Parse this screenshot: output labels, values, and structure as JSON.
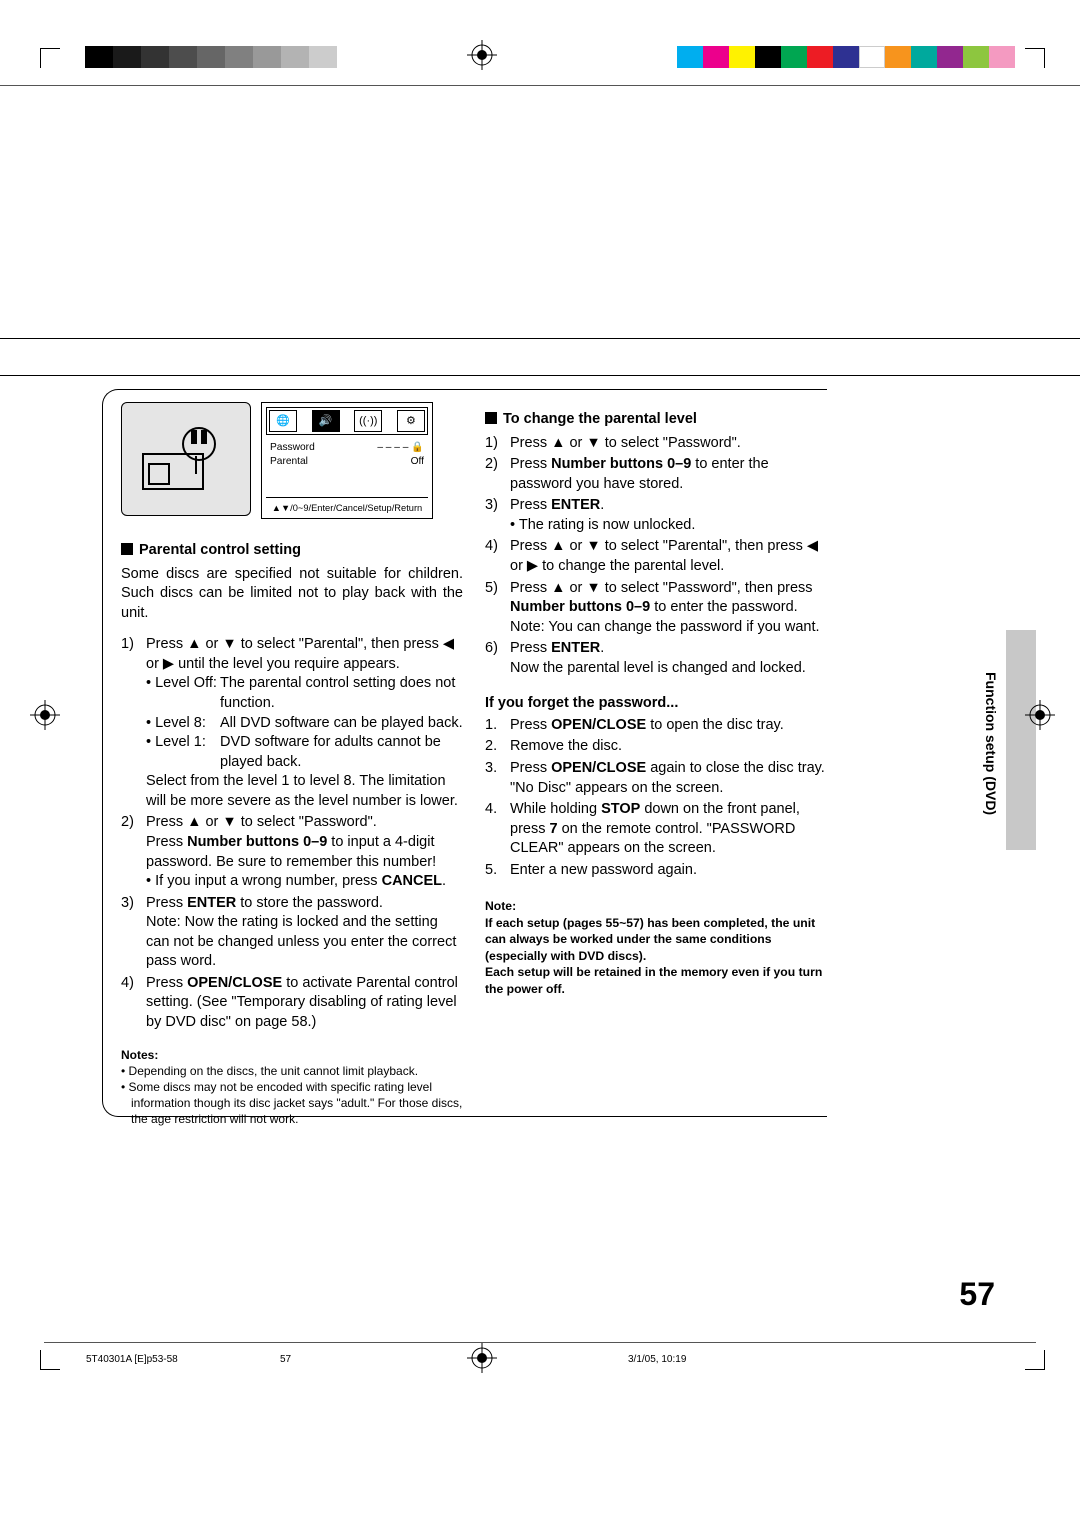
{
  "print": {
    "gray_shades": [
      "#000",
      "#1a1a1a",
      "#333",
      "#4d4d4d",
      "#666",
      "#808080",
      "#999",
      "#b3b3b3",
      "#ccc"
    ],
    "colors": [
      "#00aeef",
      "#ec008c",
      "#fff200",
      "#000",
      "#00a651",
      "#ed1c24",
      "#2e3192",
      "#fff",
      "#f7941d",
      "#00a99d",
      "#92278f",
      "#8dc63f",
      "#f49ac1"
    ]
  },
  "osd": {
    "password_label": "Password",
    "password_value": "– – – –",
    "parental_label": "Parental",
    "parental_value": "Off",
    "footer": "▲▼/0~9/Enter/Cancel/Setup/Return"
  },
  "left": {
    "heading": "Parental control setting",
    "intro": "Some discs are specified not suitable for children. Such discs can be limited not to play back with the unit.",
    "step1a": "Press ▲ or ▼ to select \"Parental\", then press ◀ or ▶ until the level you require appears.",
    "level_off_k": "• Level Off:",
    "level_off_v": "The parental control setting does not function.",
    "level_8_k": "• Level 8:",
    "level_8_v": "All DVD software can be played back.",
    "level_1_k": "• Level 1:",
    "level_1_v": "DVD software for adults cannot be played back.",
    "step1b": "Select from the level 1 to level 8. The limitation will be more severe as the level number is lower.",
    "step2a": "Press ▲ or ▼ to select \"Password\".",
    "step2b_pre": "Press ",
    "step2b_bold": "Number buttons 0–9",
    "step2b_post": " to input a 4-digit password. Be sure to remember this number!",
    "step2c_pre": "• If you input a wrong number, press ",
    "step2c_bold": "CANCEL",
    "step3a_pre": "Press ",
    "step3a_bold": "ENTER",
    "step3a_post": " to store the password.",
    "step3b": "Note: Now the rating is locked and the setting can not be changed unless you enter the correct pass word.",
    "step4_pre": "Press ",
    "step4_bold": "OPEN/CLOSE",
    "step4_post": " to activate Parental control setting. (See \"Temporary disabling of rating level by DVD disc\" on page 58.)",
    "notes_heading": "Notes:",
    "note1": "• Depending on the discs, the unit cannot limit playback.",
    "note2": "• Some discs may not be encoded with specific rating level information though its disc jacket says \"adult.\" For those discs, the age restriction will not work."
  },
  "right": {
    "heading": "To change the parental level",
    "s1": "Press ▲ or ▼ to select \"Password\".",
    "s2_pre": "Press ",
    "s2_bold": "Number buttons 0–9",
    "s2_post": " to enter the password you have stored.",
    "s3_pre": "Press ",
    "s3_bold": "ENTER",
    "s3_bullet": "• The rating is now unlocked.",
    "s4": "Press ▲ or ▼ to select \"Parental\", then press ◀ or ▶ to change the parental level.",
    "s5_a": "Press ▲ or ▼ to select \"Password\", then press ",
    "s5_bold": "Number buttons 0–9",
    "s5_b": " to enter the password.",
    "s5_note": "Note: You can change the password if you want.",
    "s6_pre": "Press ",
    "s6_bold": "ENTER",
    "s6_post": "Now the parental level is changed and locked.",
    "forgot_heading": "If you forget the password...",
    "f1_pre": "Press ",
    "f1_bold": "OPEN/CLOSE",
    "f1_post": " to open the disc tray.",
    "f2": "Remove the disc.",
    "f3_pre": "Press ",
    "f3_bold": "OPEN/CLOSE",
    "f3_post": " again to close the disc tray. \"No Disc\" appears on the screen.",
    "f4_a": "While holding ",
    "f4_bold1": "STOP",
    "f4_b": " down on the front panel, press ",
    "f4_bold2": "7",
    "f4_c": " on the remote control. \"PASSWORD CLEAR\" appears on the screen.",
    "f5": "Enter a new password again.",
    "note_label": "Note:",
    "note_body1": "If each setup (pages 55~57) has been completed, the unit can always be worked under the same conditions (especially with DVD discs).",
    "note_body2": "Each setup will be retained in the memory even if you turn the power off."
  },
  "side_tab": "Function setup (DVD)",
  "page_number": "57",
  "footer": {
    "left": "5T40301A [E]p53-58",
    "center": "57",
    "right": "3/1/05, 10:19"
  }
}
